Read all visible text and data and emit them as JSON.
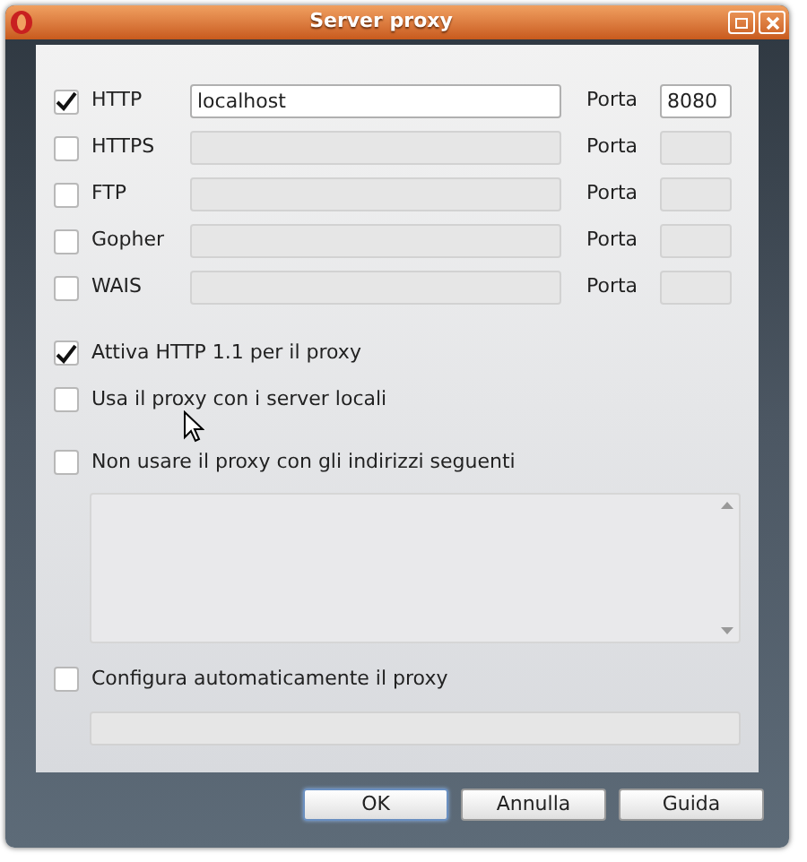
{
  "window": {
    "title": "Server proxy"
  },
  "protocols": [
    {
      "label": "HTTP",
      "checked": true,
      "host": "localhost",
      "port_label": "Porta",
      "port": "8080"
    },
    {
      "label": "HTTPS",
      "checked": false,
      "port_label": "Porta"
    },
    {
      "label": "FTP",
      "checked": false,
      "port_label": "Porta"
    },
    {
      "label": "Gopher",
      "checked": false,
      "port_label": "Porta"
    },
    {
      "label": "WAIS",
      "checked": false,
      "port_label": "Porta"
    }
  ],
  "options": [
    {
      "label": "Attiva HTTP 1.1 per il proxy",
      "checked": true
    },
    {
      "label": "Usa il proxy con i server locali",
      "checked": false
    }
  ],
  "exceptions": {
    "label": "Non usare il proxy con gli indirizzi seguenti",
    "checked": false
  },
  "auto_config": {
    "label": "Configura automaticamente il proxy",
    "checked": false
  },
  "buttons": [
    {
      "label": "OK",
      "selected": true
    },
    {
      "label": "Annulla",
      "selected": false
    },
    {
      "label": "Guida",
      "selected": false
    }
  ]
}
